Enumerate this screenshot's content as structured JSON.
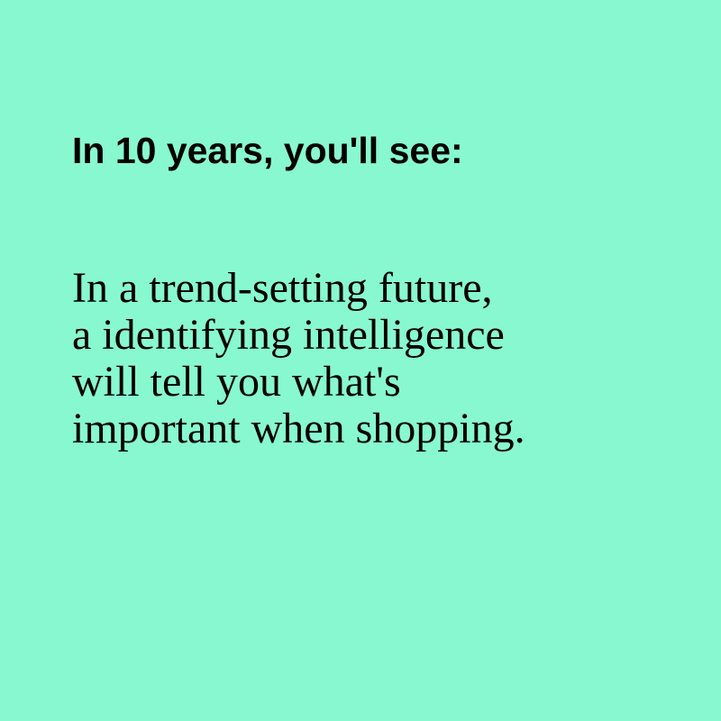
{
  "headline": "In 10 years, you'll see:",
  "body": {
    "lines": [
      "In a trend-setting future,",
      "a identifying intelligence",
      "will tell you what's",
      "important when shopping."
    ]
  },
  "colors": {
    "background": "#88F8D0",
    "text": "#000000"
  }
}
